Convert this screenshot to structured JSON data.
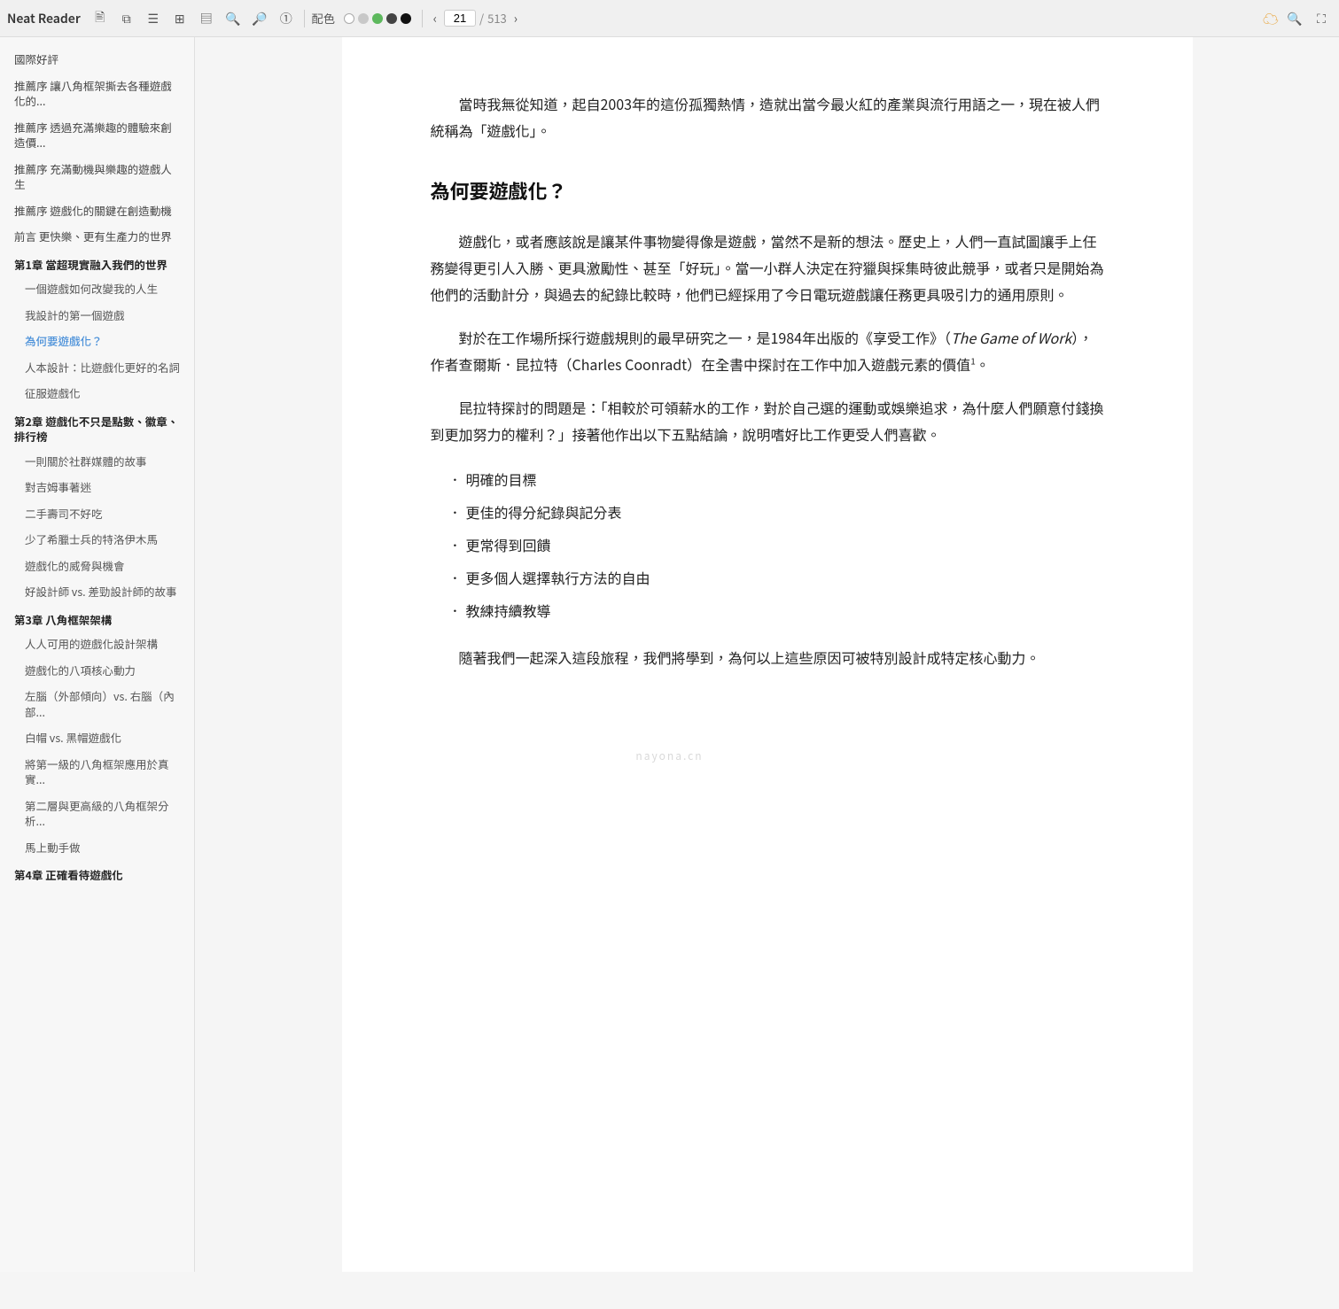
{
  "app": {
    "title": "Neat Reader"
  },
  "toolbar": {
    "icons": [
      {
        "name": "bookmark-icon",
        "symbol": "📌"
      },
      {
        "name": "copy-icon",
        "symbol": "⧉"
      },
      {
        "name": "menu-icon",
        "symbol": "≡"
      },
      {
        "name": "grid-icon",
        "symbol": "⊞"
      },
      {
        "name": "layout-icon",
        "symbol": "▤"
      },
      {
        "name": "search-icon-1",
        "symbol": "🔍"
      },
      {
        "name": "search-icon-2",
        "symbol": "🔎"
      },
      {
        "name": "zoom-icon",
        "symbol": "①"
      }
    ],
    "color_label": "配色",
    "colors": [
      {
        "name": "white-dot",
        "color": "#ffffff",
        "border": "#aaa"
      },
      {
        "name": "light-dot",
        "color": "#c8c8c8"
      },
      {
        "name": "green-dot",
        "color": "#5db85d"
      },
      {
        "name": "dark-dot",
        "color": "#444444"
      },
      {
        "name": "black-dot",
        "color": "#111111"
      }
    ],
    "page_current": "21",
    "page_total": "513",
    "right_icons": [
      {
        "name": "cloud-icon",
        "symbol": "☁"
      },
      {
        "name": "search-right-icon",
        "symbol": "🔍"
      },
      {
        "name": "fullscreen-icon",
        "symbol": "⛶"
      }
    ]
  },
  "sidebar": {
    "items": [
      {
        "id": "s0",
        "label": "國際好評",
        "level": "top",
        "active": false
      },
      {
        "id": "s1",
        "label": "推薦序 讓八角框架撕去各種遊戲化的...",
        "level": "top",
        "active": false
      },
      {
        "id": "s2",
        "label": "推薦序 透過充滿樂趣的體驗來創造價...",
        "level": "top",
        "active": false
      },
      {
        "id": "s3",
        "label": "推薦序 充滿動機與樂趣的遊戲人生",
        "level": "top",
        "active": false
      },
      {
        "id": "s4",
        "label": "推薦序 遊戲化的關鍵在創造動機",
        "level": "top",
        "active": false
      },
      {
        "id": "s5",
        "label": "前言 更快樂、更有生產力的世界",
        "level": "top",
        "active": false
      },
      {
        "id": "s6",
        "label": "第1章 當超現實融入我們的世界",
        "level": "chapter",
        "active": false
      },
      {
        "id": "s7",
        "label": "一個遊戲如何改變我的人生",
        "level": "sub",
        "active": false
      },
      {
        "id": "s8",
        "label": "我設計的第一個遊戲",
        "level": "sub",
        "active": false
      },
      {
        "id": "s9",
        "label": "為何要遊戲化？",
        "level": "sub",
        "active": true
      },
      {
        "id": "s10",
        "label": "人本設計：比遊戲化更好的名詞",
        "level": "sub",
        "active": false
      },
      {
        "id": "s11",
        "label": "征服遊戲化",
        "level": "sub",
        "active": false
      },
      {
        "id": "s12",
        "label": "第2章 遊戲化不只是點數、徽章、排行榜",
        "level": "chapter",
        "active": false
      },
      {
        "id": "s13",
        "label": "一則關於社群媒體的故事",
        "level": "sub",
        "active": false
      },
      {
        "id": "s14",
        "label": "對吉姆事著迷",
        "level": "sub",
        "active": false
      },
      {
        "id": "s15",
        "label": "二手壽司不好吃",
        "level": "sub",
        "active": false
      },
      {
        "id": "s16",
        "label": "少了希臘士兵的特洛伊木馬",
        "level": "sub",
        "active": false
      },
      {
        "id": "s17",
        "label": "遊戲化的威脅與機會",
        "level": "sub",
        "active": false
      },
      {
        "id": "s18",
        "label": "好設計師 vs. 差勁設計師的故事",
        "level": "sub",
        "active": false
      },
      {
        "id": "s19",
        "label": "第3章 八角框架架構",
        "level": "chapter",
        "active": false
      },
      {
        "id": "s20",
        "label": "人人可用的遊戲化設計架構",
        "level": "sub",
        "active": false
      },
      {
        "id": "s21",
        "label": "遊戲化的八項核心動力",
        "level": "sub",
        "active": false
      },
      {
        "id": "s22",
        "label": "左腦（外部傾向）vs. 右腦（內部...",
        "level": "sub",
        "active": false
      },
      {
        "id": "s23",
        "label": "白帽 vs. 黑帽遊戲化",
        "level": "sub",
        "active": false
      },
      {
        "id": "s24",
        "label": "將第一級的八角框架應用於真實...",
        "level": "sub",
        "active": false
      },
      {
        "id": "s25",
        "label": "第二層與更高級的八角框架分析...",
        "level": "sub",
        "active": false
      },
      {
        "id": "s26",
        "label": "馬上動手做",
        "level": "sub",
        "active": false
      },
      {
        "id": "s27",
        "label": "第4章 正確看待遊戲化",
        "level": "chapter",
        "active": false
      }
    ]
  },
  "content": {
    "intro_paragraph": "當時我無從知道，起自2003年的這份孤獨熱情，造就出當今最火紅的產業與流行用語之一，現在被人們統稱為「遊戲化」。",
    "section_title": "為何要遊戲化？",
    "para1": "遊戲化，或者應該說是讓某件事物變得像是遊戲，當然不是新的想法。歷史上，人們一直試圖讓手上任務變得更引人入勝、更具激勵性、甚至「好玩」。當一小群人決定在狩獵與採集時彼此競爭，或者只是開始為他們的活動計分，與過去的紀錄比較時，他們已經採用了今日電玩遊戲讓任務更具吸引力的通用原則。",
    "para2_start": "對於在工作場所採行遊戲規則的最早研究之一，是1984年出版的《享受工作》（",
    "para2_title": "The Game of Work",
    "para2_mid": "），作者查爾斯．昆拉特（Charles Coonradt）在全書中探討在工作中加入遊戲元素的價值",
    "para2_sup": "1",
    "para2_end": "。",
    "para3": "昆拉特探討的問題是：「相較於可領薪水的工作，對於自己選的運動或娛樂追求，為什麼人們願意付錢換到更加努力的權利？」接著他作出以下五點結論，說明嗜好比工作更受人們喜歡。",
    "bullet_points": [
      "明確的目標",
      "更佳的得分紀錄與記分表",
      "更常得到回饋",
      "更多個人選擇執行方法的自由",
      "教練持續教導"
    ],
    "para4": "隨著我們一起深入這段旅程，我們將學到，為何以上這些原因可被特別設計成特定核心動力。",
    "watermark": "nayona.cn"
  }
}
